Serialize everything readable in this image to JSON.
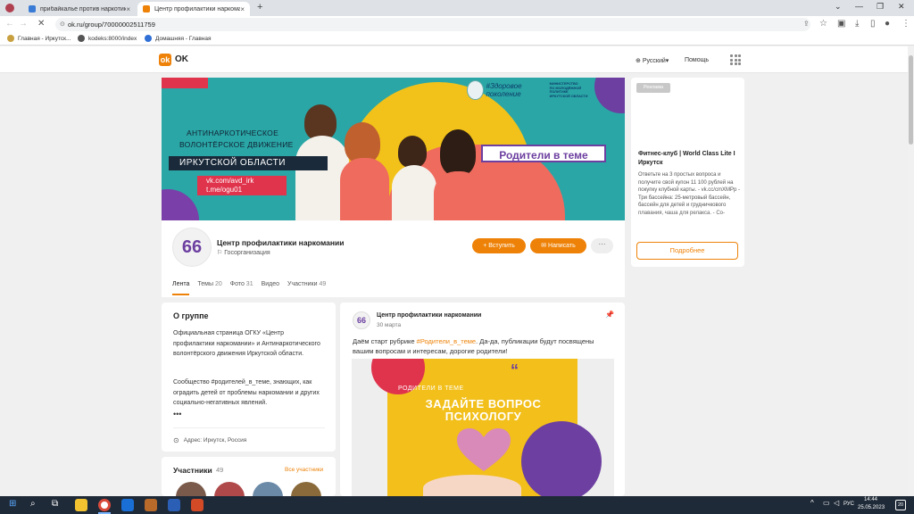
{
  "browser": {
    "tabs": [
      {
        "label": "прибайкалье против наркотико..."
      },
      {
        "label": "Центр профилактики наркомании"
      }
    ],
    "new_tab": "+",
    "url": "ok.ru/group/70000002511759",
    "bookmarks": [
      "Главная - Иркутск...",
      "kodeks:8000/index",
      "Домашняя - Главная"
    ]
  },
  "site": {
    "logo_text": "OK",
    "language": "Русский",
    "help": "Помощь"
  },
  "banner": {
    "line1": "АНТИНАРКОТИЧЕСКОЕ",
    "line2": "ВОЛОНТЁРСКОЕ ДВИЖЕНИЕ",
    "region": "ИРКУТСКОЙ ОБЛАСТИ",
    "link1": "vk.com/avd_irk",
    "link2": "t.me/ogu01",
    "tag": "Родители в теме",
    "ministry_script": "#Здоровое поколение",
    "ministry_l1": "МИНИСТЕРСТВО",
    "ministry_l2": "ПО МОЛОДЁЖНОЙ ПОЛИТИКЕ",
    "ministry_l3": "ИРКУТСКОЙ ОБЛАСТИ"
  },
  "group": {
    "avatar_glyph": "66",
    "title": "Центр профилактики наркомании",
    "type": "Госорганизация",
    "join": "Вступить",
    "write": "Написать",
    "more": "···",
    "tabs": [
      {
        "label": "Лента",
        "count": ""
      },
      {
        "label": "Темы",
        "count": "20"
      },
      {
        "label": "Фото",
        "count": "31"
      },
      {
        "label": "Видео",
        "count": ""
      },
      {
        "label": "Участники",
        "count": "49"
      }
    ]
  },
  "about": {
    "title": "О группе",
    "p1": "Официальная страница ОГКУ «Центр профилактики наркомании» и Антинаркотического волонтёрского движения Иркутской области.",
    "p2": "Сообщество #родителей_в_теме, знающих, как оградить детей от проблемы наркомании и других социально-негативных явлений.",
    "more": "•••",
    "address": "Адрес: Иркутск, Россия"
  },
  "members": {
    "title": "Участники",
    "count": "49",
    "all": "Все участники"
  },
  "post": {
    "author": "Центр профилактики наркомании",
    "date": "30 марта",
    "text_before": "Даём старт рубрике ",
    "hashtag": "#Родители_в_теме",
    "text_after": ". Да-да, публикации будут посвящены вашим вопросам и интересам, дорогие родители!",
    "image_line1": "РОДИТЕЛИ В ТЕМЕ",
    "image_line2": "ЗАДАЙТЕ ВОПРОС ПСИХОЛОГУ"
  },
  "ad": {
    "badge": "Реклама",
    "title": "Фитнес-клуб | World Class Lite I Иркутск",
    "desc": "Ответьте на 3 простых вопроса и получите свой купон 11 100 рублей на покупку клубной карты. - vk.cc/cmXMPp - Три бассейна: 25-метровый бассейн, бассейн для детей и грудничкового плавания, чаша для релакса. - Со-",
    "button": "Подробнее"
  },
  "taskbar": {
    "lang": "РУС",
    "time": "14:44",
    "date": "25.05.2023",
    "notif": "20"
  },
  "colors": {
    "accent": "#ee8208",
    "banner_teal": "#2aa6a6",
    "purple": "#6c3fa0",
    "red": "#e0334c",
    "yellow": "#f2c21a"
  }
}
